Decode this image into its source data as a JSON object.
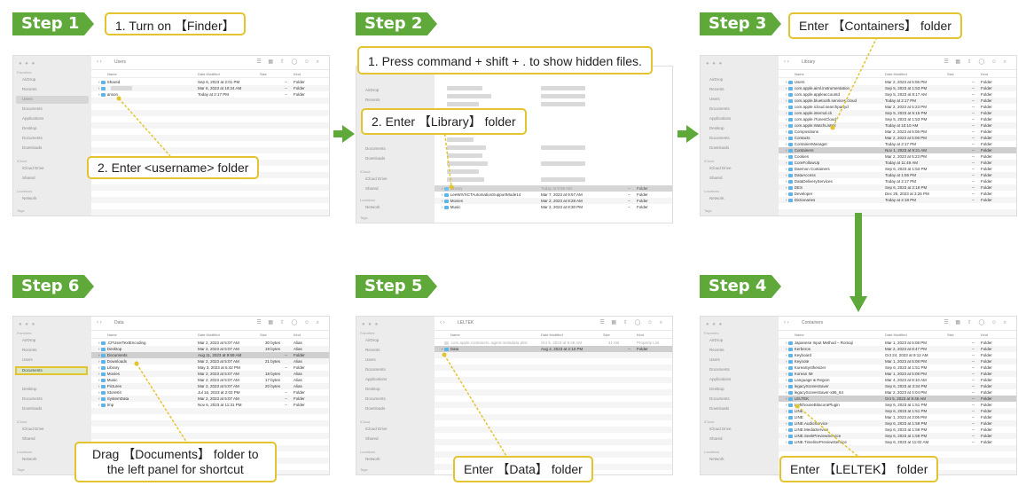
{
  "steps": {
    "s1": {
      "tab": "Step 1",
      "callout_a": "1. Turn on 【Finder】",
      "callout_b": "2. Enter <username> folder"
    },
    "s2": {
      "tab": "Step 2",
      "callout_a": "1. Press command + shift + . to show hidden files.",
      "callout_b": "2. Enter 【Library】 folder"
    },
    "s3": {
      "tab": "Step 3",
      "callout_a": "Enter 【Containers】 folder"
    },
    "s4": {
      "tab": "Step 4",
      "callout_a": "Enter 【LELTEK】 folder"
    },
    "s5": {
      "tab": "Step 5",
      "callout_a": "Enter 【Data】 folder"
    },
    "s6": {
      "tab": "Step 6",
      "callout_a": "Drag 【Documents】 folder to\nthe left panel for shortcut"
    }
  },
  "sidebar": {
    "favorites": "Favorites",
    "items": [
      "AirDrop",
      "Recents",
      "Users",
      "Documents",
      "Applications",
      "Desktop",
      "Documents",
      "Downloads"
    ],
    "icloud": "iCloud",
    "icloud_items": [
      "iCloud Drive",
      "Shared"
    ],
    "locations": "Locations",
    "location_items": [
      "Network"
    ],
    "tags": "Tags"
  },
  "columns": {
    "name": "Name",
    "date": "Date Modified",
    "size": "Size",
    "kind": "Kind"
  },
  "windows": {
    "w1": {
      "title": "Users",
      "rows": [
        {
          "name": "Shared",
          "date": "Sep 6, 2023 at 2:01 PM",
          "size": "--",
          "kind": "Folder"
        },
        {
          "name": "",
          "date": "Mar 6, 2023 at 10:24 AM",
          "size": "--",
          "kind": "Folder"
        },
        {
          "name": "anson",
          "date": "Today at 2:17 PM",
          "size": "--",
          "kind": "Folder"
        }
      ]
    },
    "w2": {
      "rows": [
        {
          "name": "Library",
          "date": "Today at 9:58 AM",
          "size": "--",
          "kind": "Folder"
        },
        {
          "name": "LeeWIVXCTAutomationSupportMode14",
          "date": "Mar 7, 2023 at 9:57 AM",
          "size": "--",
          "kind": "Folder"
        },
        {
          "name": "Movies",
          "date": "Mar 2, 2023 at 8:28 AM",
          "size": "--",
          "kind": "Folder"
        },
        {
          "name": "Music",
          "date": "Mar 2, 2023 at 8:30 PM",
          "size": "--",
          "kind": "Folder"
        }
      ]
    },
    "w3": {
      "title": "Library",
      "rows": [
        {
          "name": "Users",
          "date": "Mar 2, 2023 at 5:06 PM",
          "kind": "Folder"
        },
        {
          "name": "com.apple.aiml.instrumentation",
          "date": "Sep 5, 2023 at 1:53 PM",
          "kind": "Folder"
        },
        {
          "name": "com.apple.appleaccountd",
          "date": "Sep 5, 2023 at 8:17 AM",
          "kind": "Folder"
        },
        {
          "name": "com.apple.bluetooth.services.cloud",
          "date": "Today at 2:17 PM",
          "kind": "Folder"
        },
        {
          "name": "com.apple.icloud.searchpartyd",
          "date": "Mar 2, 2023 at 5:23 PM",
          "kind": "Folder"
        },
        {
          "name": "com.apple.internal.ck",
          "date": "Sep 5, 2023 at 5:15 PM",
          "kind": "Folder"
        },
        {
          "name": "com.apple.iTunesCloud",
          "date": "Sep 5, 2023 at 1:53 PM",
          "kind": "Folder"
        },
        {
          "name": "com.apple.WatchListKit",
          "date": "Today at 10:10 AM",
          "kind": "Folder"
        },
        {
          "name": "Compositions",
          "date": "Mar 2, 2023 at 5:06 PM",
          "kind": "Folder"
        },
        {
          "name": "Contacts",
          "date": "Mar 2, 2023 at 5:06 PM",
          "kind": "Folder"
        },
        {
          "name": "ContainerManager",
          "date": "Today at 2:17 PM",
          "kind": "Folder"
        },
        {
          "name": "Containers",
          "date": "Nov 1, 2023 at 9:21 AM",
          "kind": "Folder"
        },
        {
          "name": "Cookies",
          "date": "Mar 2, 2023 at 5:23 PM",
          "kind": "Folder"
        },
        {
          "name": "CoreFollowUp",
          "date": "Today at 11:49 AM",
          "kind": "Folder"
        },
        {
          "name": "Daemon Containers",
          "date": "Sep 6, 2023 at 1:53 PM",
          "kind": "Folder"
        },
        {
          "name": "DataAccess",
          "date": "Today at 1:55 PM",
          "kind": "Folder"
        },
        {
          "name": "DataDeliveryServices",
          "date": "Today at 2:17 PM",
          "kind": "Folder"
        },
        {
          "name": "DES",
          "date": "Sep 6, 2023 at 2:18 PM",
          "kind": "Folder"
        },
        {
          "name": "Developer",
          "date": "Dec 25, 2023 at 3:26 PM",
          "kind": "Folder"
        },
        {
          "name": "Dictionaries",
          "date": "Today at 2:18 PM",
          "kind": "Folder"
        }
      ]
    },
    "w4": {
      "title": "Containers",
      "rows": [
        {
          "name": "Japanese Input Method – Romaji",
          "date": "Mar 1, 2023 at 5:08 PM",
          "kind": "Folder"
        },
        {
          "name": "Kerberos",
          "date": "Mar 2, 2023 at 8:47 PM",
          "kind": "Folder"
        },
        {
          "name": "Keyboard",
          "date": "Oct 24, 2023 at 9:12 AM",
          "kind": "Folder"
        },
        {
          "name": "Keynote",
          "date": "Mar 1, 2023 at 5:08 PM",
          "kind": "Folder"
        },
        {
          "name": "KoreaSynthesizer",
          "date": "Sep 6, 2023 at 1:51 PM",
          "kind": "Folder"
        },
        {
          "name": "Korean IM",
          "date": "Mar 1, 2023 at 5:08 PM",
          "kind": "Folder"
        },
        {
          "name": "Language & Region",
          "date": "Mar 4, 2023 at 8:10 AM",
          "kind": "Folder"
        },
        {
          "name": "legacyScreenSaver",
          "date": "Sep 6, 2023 at 3:34 PM",
          "kind": "Folder"
        },
        {
          "name": "legacyScreenSaver-x86_64",
          "date": "Mar 2, 2023 at 4:04 PM",
          "kind": "Folder"
        },
        {
          "name": "LELTEK",
          "date": "Oct 5, 2023 at 9:46 AM",
          "kind": "Folder"
        },
        {
          "name": "LighthouseBitacoraPlugin",
          "date": "Sep 6, 2023 at 1:51 PM",
          "kind": "Folder"
        },
        {
          "name": "LINE",
          "date": "Sep 6, 2023 at 1:51 PM",
          "kind": "Folder"
        },
        {
          "name": "LINE",
          "date": "Mar 1, 2023 at 3:06 PM",
          "kind": "Folder"
        },
        {
          "name": "LINE.AudioService",
          "date": "Sep 6, 2023 at 1:59 PM",
          "kind": "Folder"
        },
        {
          "name": "LINE.MediaService",
          "date": "Sep 6, 2023 at 1:59 PM",
          "kind": "Folder"
        },
        {
          "name": "LINE.SeekPreviewService",
          "date": "Sep 6, 2023 at 1:59 PM",
          "kind": "Folder"
        },
        {
          "name": "LINE.TimelinePreviewService",
          "date": "Sep 6, 2023 at 11:02 AM",
          "kind": "Folder"
        }
      ]
    },
    "w5": {
      "title": "LELTEK",
      "rows": [
        {
          "name": ".com.apple.containers..agent.metadata.plist",
          "date": "Oct 5, 2023 at 9:46 AM",
          "size": "41 KB",
          "kind": "Property List"
        },
        {
          "name": "Data",
          "date": "Aug 2, 2023 at 2:10 PM",
          "size": "--",
          "kind": "Folder"
        }
      ]
    },
    "w6": {
      "title": "Data",
      "rows": [
        {
          "name": ".CFUserTextEncoding",
          "date": "Mar 2, 2023 at 5:07 AM",
          "size": "30 bytes",
          "kind": "Alias"
        },
        {
          "name": "Desktop",
          "date": "Mar 2, 2023 at 5:07 AM",
          "size": "19 bytes",
          "kind": "Alias"
        },
        {
          "name": "Documents",
          "date": "Aug 11, 2023 at 9:59 AM",
          "size": "--",
          "kind": "Folder"
        },
        {
          "name": "Downloads",
          "date": "Mar 2, 2023 at 5:07 AM",
          "size": "21 bytes",
          "kind": "Alias"
        },
        {
          "name": "Library",
          "date": "May 3, 2023 at 5:42 PM",
          "size": "--",
          "kind": "Folder"
        },
        {
          "name": "Movies",
          "date": "Mar 2, 2023 at 5:07 AM",
          "size": "18 bytes",
          "kind": "Alias"
        },
        {
          "name": "Music",
          "date": "Mar 2, 2023 at 5:07 AM",
          "size": "17 bytes",
          "kind": "Alias"
        },
        {
          "name": "Pictures",
          "date": "Mar 2, 2023 at 5:07 AM",
          "size": "20 bytes",
          "kind": "Alias"
        },
        {
          "name": "StoreKit",
          "date": "Jul 16, 2023 at 2:02 PM",
          "size": "--",
          "kind": "Folder"
        },
        {
          "name": "SystemData",
          "date": "Mar 2, 2023 at 5:07 AM",
          "size": "--",
          "kind": "Folder"
        },
        {
          "name": "tmp",
          "date": "Nov 6, 2023 at 11:31 PM",
          "size": "--",
          "kind": "Folder"
        }
      ]
    }
  },
  "colors": {
    "step_green": "#5fa83a",
    "callout_border": "#e3c42e",
    "folder_blue": "#5bb5ea"
  }
}
